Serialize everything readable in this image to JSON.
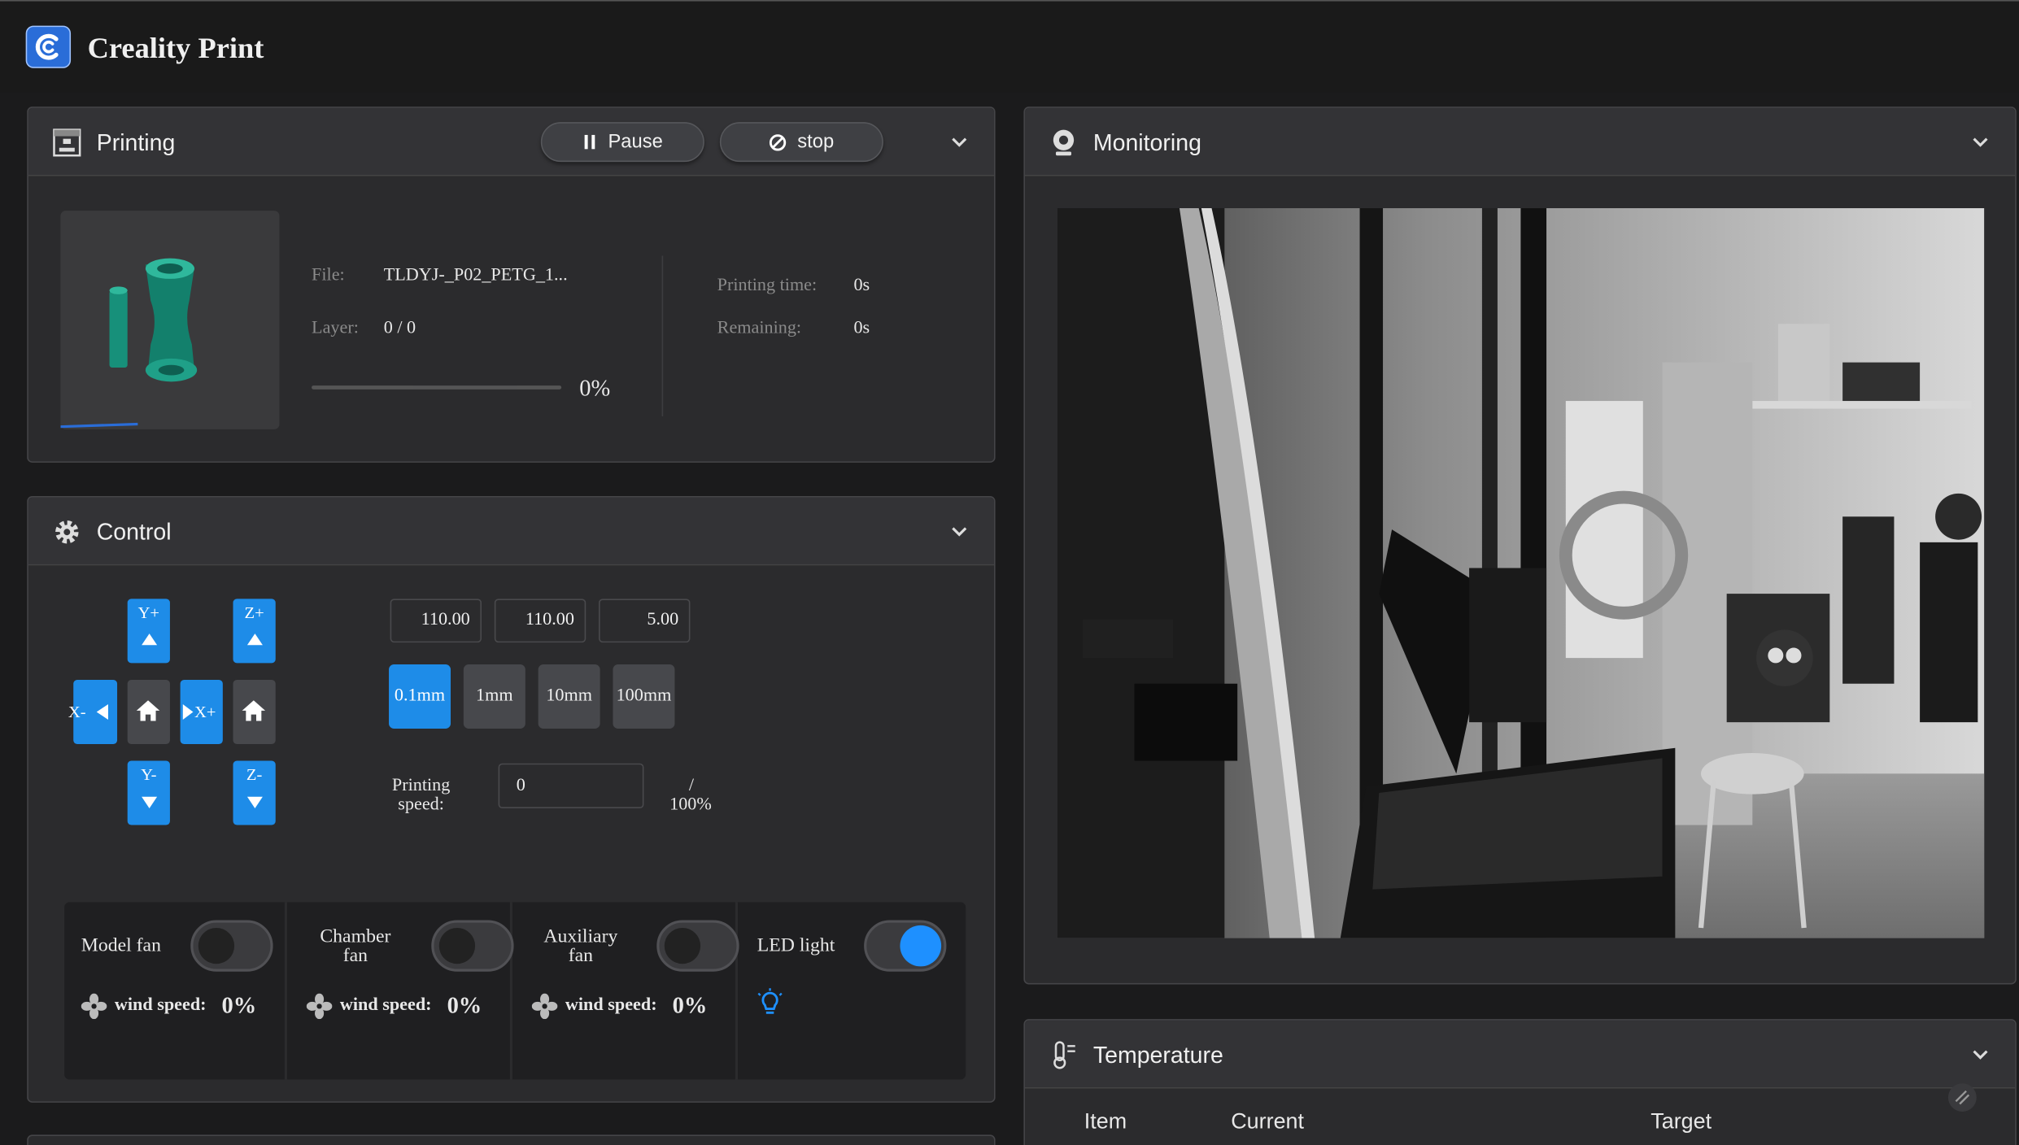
{
  "app": {
    "title": "Creality Print"
  },
  "printing": {
    "title": "Printing",
    "pause_label": "Pause",
    "stop_label": "stop",
    "file_label": "File:",
    "file_value": "TLDYJ-_P02_PETG_1...",
    "layer_label": "Layer:",
    "layer_value": "0 / 0",
    "progress_percent": 0,
    "progress_text": "0%",
    "printing_time_label": "Printing time:",
    "printing_time_value": "0s",
    "remaining_label": "Remaining:",
    "remaining_value": "0s"
  },
  "control": {
    "title": "Control",
    "y_plus": "Y+",
    "y_minus": "Y-",
    "x_minus": "X-",
    "x_plus": "X+",
    "z_plus": "Z+",
    "z_minus": "Z-",
    "coords": [
      "110.00",
      "110.00",
      "5.00"
    ],
    "steps": [
      "0.1mm",
      "1mm",
      "10mm",
      "100mm"
    ],
    "active_step": "0.1mm",
    "speed_label": "Printing speed:",
    "speed_value": "0",
    "speed_slash": "/",
    "speed_percent": "100%",
    "fans": [
      {
        "name": "Model fan",
        "wind_label": "wind speed:",
        "wind_value": "0%",
        "on": false
      },
      {
        "name": "Chamber fan",
        "wind_label": "wind speed:",
        "wind_value": "0%",
        "on": false
      },
      {
        "name": "Auxiliary fan",
        "wind_label": "wind speed:",
        "wind_value": "0%",
        "on": false
      }
    ],
    "led": {
      "name": "LED light",
      "on": true
    }
  },
  "monitoring": {
    "title": "Monitoring"
  },
  "temperature": {
    "title": "Temperature",
    "columns": [
      "Item",
      "Current",
      "Target"
    ]
  },
  "colors": {
    "accent": "#1e8ce8",
    "panel": "#2b2b2d",
    "header": "#333336"
  },
  "icons": [
    "creality-logo-icon",
    "printer-icon",
    "pause-icon",
    "stop-icon",
    "chevron-down-icon",
    "gear-icon",
    "home-icon",
    "fan-icon",
    "bulb-icon",
    "camera-icon",
    "thermometer-icon",
    "resize-handle-icon"
  ]
}
